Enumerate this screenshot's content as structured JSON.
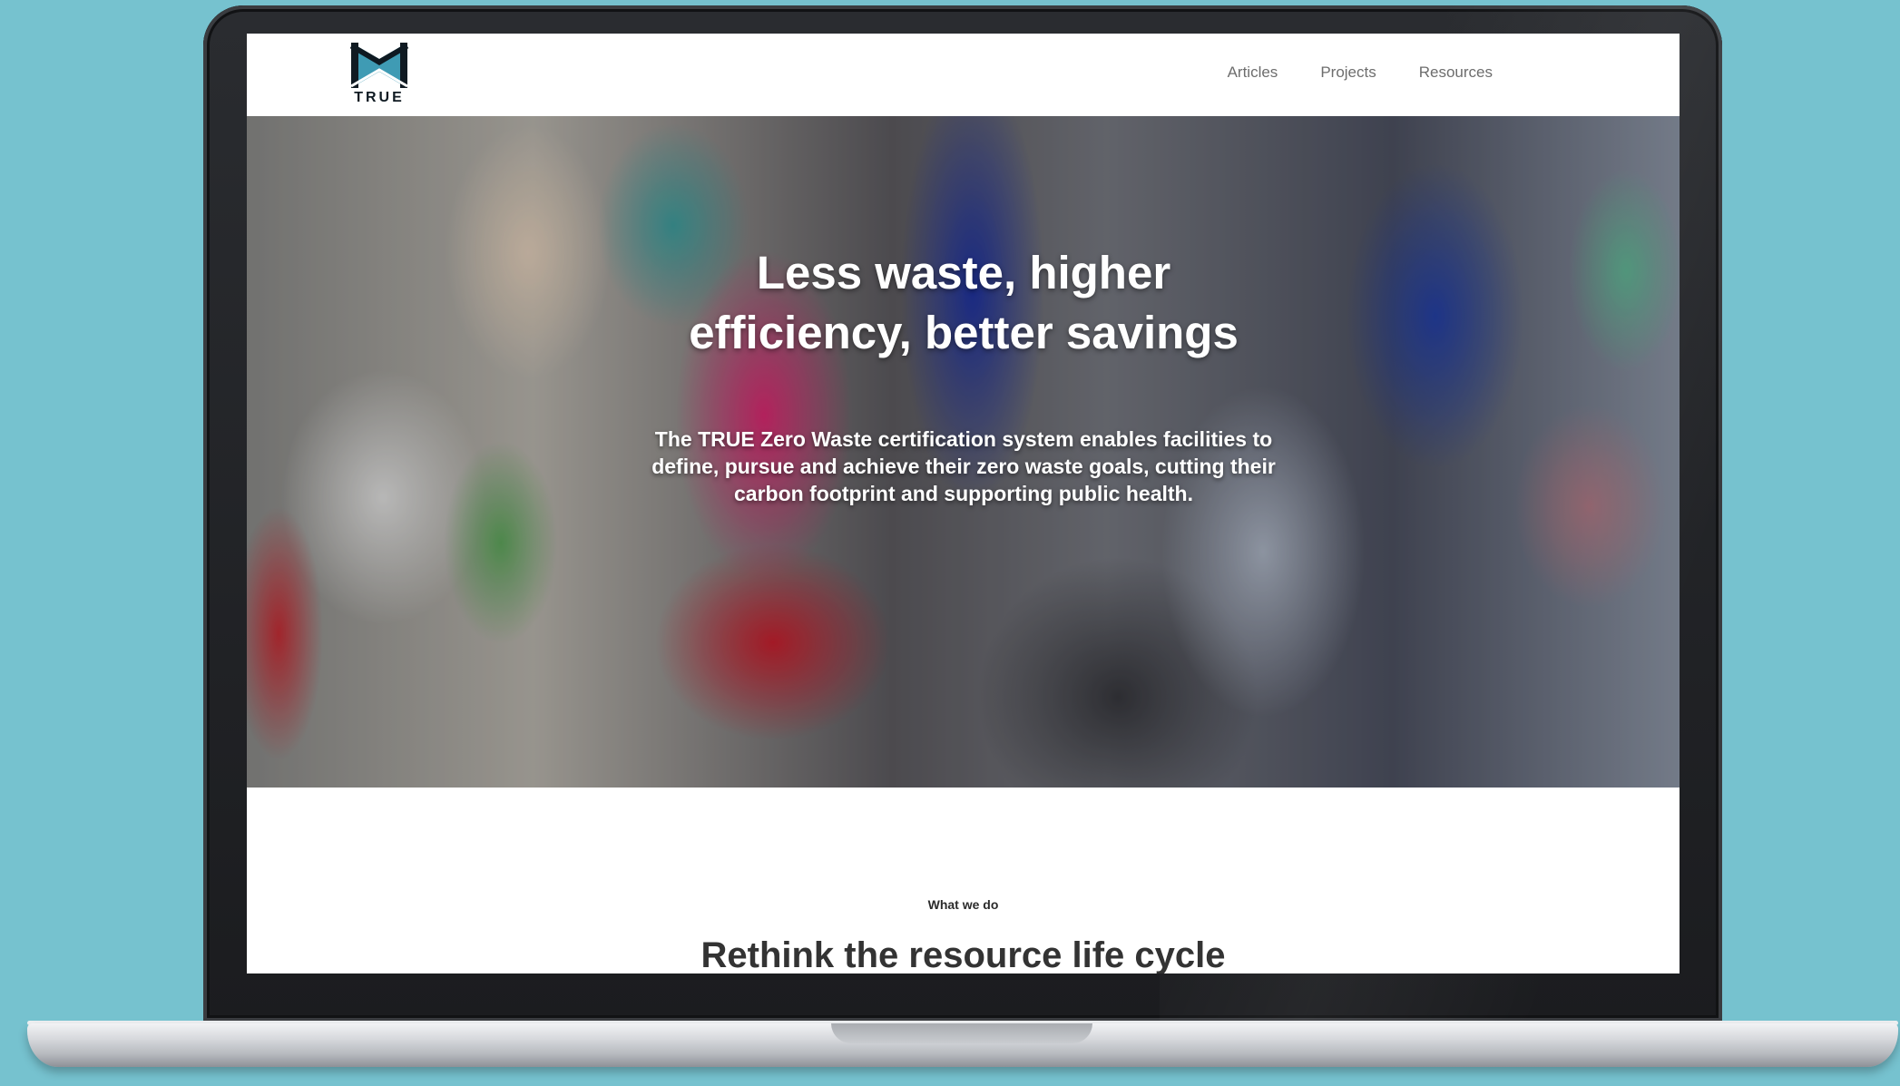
{
  "site": {
    "logo_text": "TRUE",
    "logo_colors": {
      "accent": "#3f9bb4",
      "dark": "#0f1a22"
    }
  },
  "nav": {
    "items": [
      {
        "label": "Articles"
      },
      {
        "label": "Projects"
      },
      {
        "label": "Resources"
      }
    ]
  },
  "hero": {
    "title_line1": "Less waste, higher",
    "title_line2": "efficiency, better savings",
    "subtitle": "The TRUE Zero Waste certification system enables facilities to define, pursue and achieve their zero waste goals, cutting their carbon footprint and supporting public health."
  },
  "what_we_do": {
    "eyebrow": "What we do",
    "heading": "Rethink the resource life cycle"
  },
  "colors": {
    "background": "#76c2cf",
    "nav_text": "#6d6d6d",
    "heading_text": "#333333"
  }
}
